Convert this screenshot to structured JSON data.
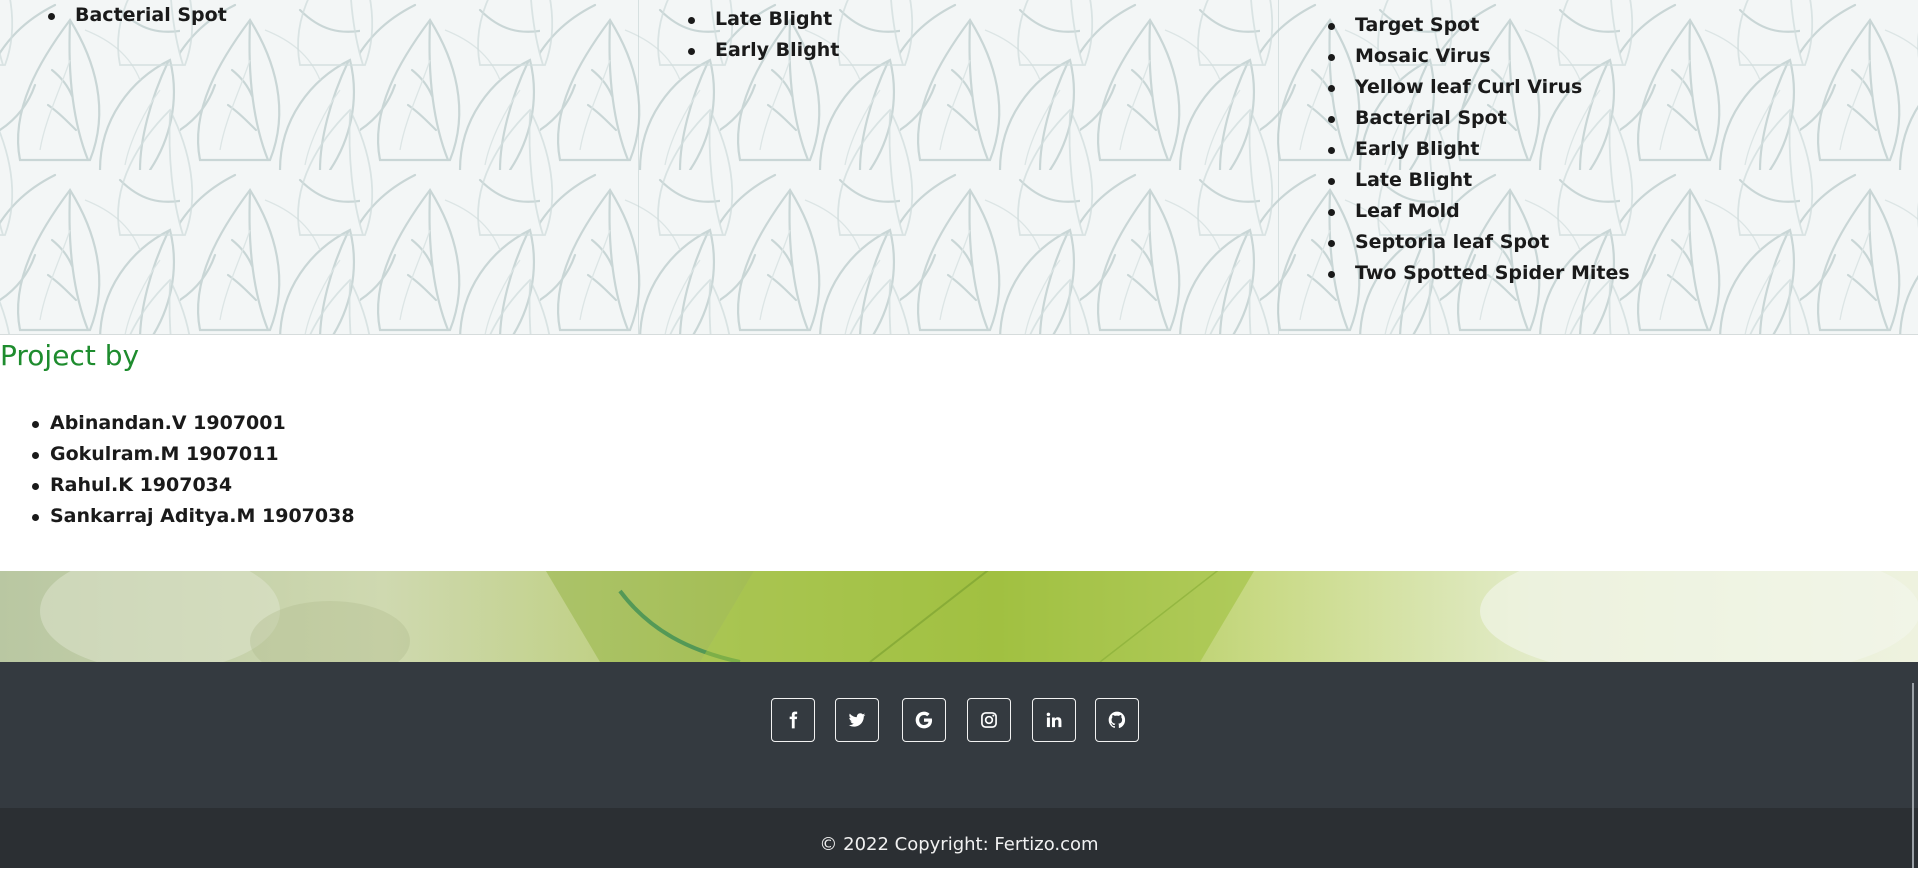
{
  "diseases": {
    "column1": [
      "Bacterial Spot"
    ],
    "column2": [
      "Late Blight",
      "Early Blight"
    ],
    "column3": [
      "Target Spot",
      "Mosaic Virus",
      "Yellow leaf Curl Virus",
      "Bacterial Spot",
      "Early Blight",
      "Late Blight",
      "Leaf Mold",
      "Septoria leaf Spot",
      "Two Spotted Spider Mites"
    ]
  },
  "project": {
    "title": "Project by",
    "members": [
      "Abinandan.V 1907001",
      "Gokulram.M 1907011",
      "Rahul.K 1907034",
      "Sankarraj Aditya.M 1907038"
    ]
  },
  "footer": {
    "social": [
      {
        "name": "facebook",
        "icon": "facebook-icon"
      },
      {
        "name": "twitter",
        "icon": "twitter-icon"
      },
      {
        "name": "google",
        "icon": "google-icon"
      },
      {
        "name": "instagram",
        "icon": "instagram-icon"
      },
      {
        "name": "linkedin",
        "icon": "linkedin-icon"
      },
      {
        "name": "github",
        "icon": "github-icon"
      }
    ],
    "copyright": "© 2022 Copyright: Fertizo.com"
  },
  "colors": {
    "title_green": "#1e8c2e",
    "footer_bg": "#343a40",
    "copyright_bg": "#2b2f33"
  }
}
